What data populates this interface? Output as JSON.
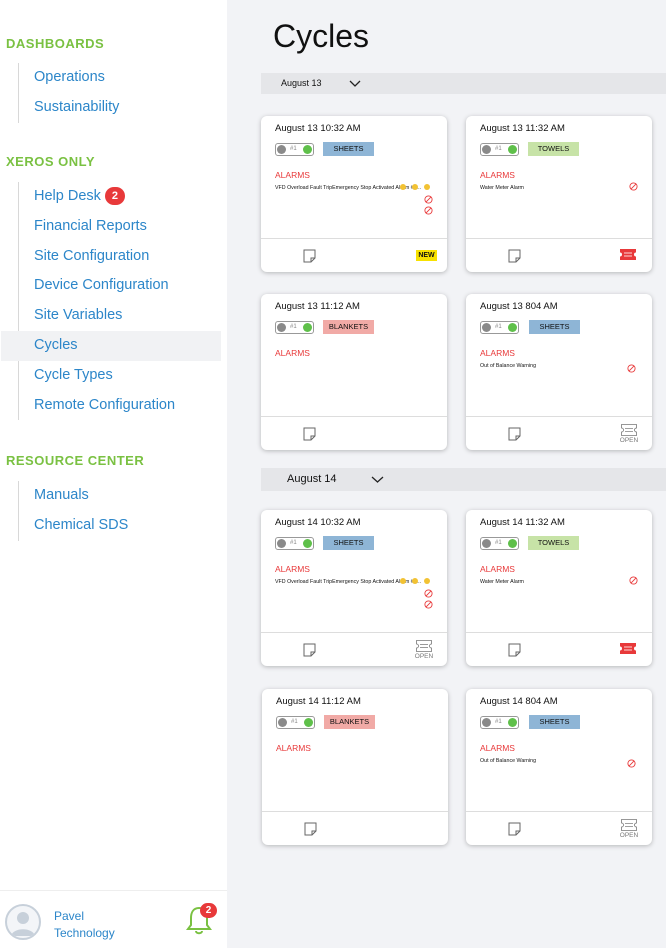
{
  "sidebar": {
    "sections": [
      {
        "title": "DASHBOARDS",
        "items": [
          {
            "label": "Operations"
          },
          {
            "label": "Sustainability"
          }
        ]
      },
      {
        "title": "XEROS ONLY",
        "items": [
          {
            "label": "Help Desk",
            "badge": "2"
          },
          {
            "label": "Financial Reports"
          },
          {
            "label": "Site Configuration"
          },
          {
            "label": "Device Configuration"
          },
          {
            "label": "Site Variables"
          },
          {
            "label": "Cycles",
            "active": true
          },
          {
            "label": "Cycle Types"
          },
          {
            "label": "Remote Configuration"
          }
        ]
      },
      {
        "title": "RESOURCE CENTER",
        "items": [
          {
            "label": "Manuals"
          },
          {
            "label": "Chemical SDS"
          }
        ]
      }
    ],
    "user": {
      "name_line1": "Pavel",
      "name_line2": "Technology",
      "notification_count": "2"
    }
  },
  "main": {
    "title": "Cycles",
    "groups": [
      {
        "date": "August 13",
        "cards": [
          {
            "time": "August 13 10:32 AM",
            "machine": "#1",
            "type": "SHEETS",
            "alarms_label": "ALARMS",
            "alarm_text": "VFD Overload Fault TripEmergency Stop Activated Alarm #3...",
            "status": "NEW"
          },
          {
            "time": "August 13  11:32 AM",
            "machine": "#1",
            "type": "TOWELS",
            "alarms_label": "ALARMS",
            "alarm_text": "Water Meter Alarm",
            "status": "ticket"
          },
          {
            "time": "August 13 11:12 AM",
            "machine": "#1",
            "type": "BLANKETS",
            "alarms_label": "ALARMS",
            "alarm_text": "",
            "status": "none"
          },
          {
            "time": "August 13 804 AM",
            "machine": "#1",
            "type": "SHEETS",
            "alarms_label": "ALARMS",
            "alarm_text": "Out of Balance Warning",
            "status": "OPEN"
          }
        ]
      },
      {
        "date": "August 14",
        "cards": [
          {
            "time": "August 14 10:32 AM",
            "machine": "#1",
            "type": "SHEETS",
            "alarms_label": "ALARMS",
            "alarm_text": "VFD Overload Fault TripEmergency Stop Activated Alarm #3...",
            "status": "OPEN"
          },
          {
            "time": "August 14 11:32 AM",
            "machine": "#1",
            "type": "TOWELS",
            "alarms_label": "ALARMS",
            "alarm_text": "Water Meter Alarm",
            "status": "ticket"
          },
          {
            "time": "August 14 11:12 AM",
            "machine": "#1",
            "type": "BLANKETS",
            "alarms_label": "ALARMS",
            "alarm_text": "",
            "status": "none"
          },
          {
            "time": "August 14 804 AM",
            "machine": "#1",
            "type": "SHEETS",
            "alarms_label": "ALARMS",
            "alarm_text": "Out of Balance Warning",
            "status": "OPEN"
          }
        ]
      }
    ]
  },
  "colors": {
    "accent_green": "#7ac142",
    "link_blue": "#2c86c9",
    "alarm_red": "#e8393a",
    "new_yellow": "#f7e100"
  }
}
